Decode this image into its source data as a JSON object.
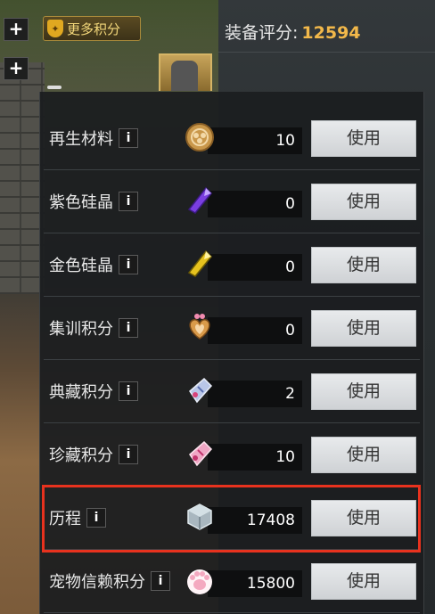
{
  "header": {
    "more_points_label": "更多积分",
    "score_label": "装备评分:",
    "score_value": "12594",
    "plus_icon": "+"
  },
  "info_glyph": "i",
  "use_label": "使用",
  "items": [
    {
      "name": "再生材料",
      "count": "10",
      "icon": "coin-icon",
      "color": "#c9974a"
    },
    {
      "name": "紫色硅晶",
      "count": "0",
      "icon": "purple-crystal-icon",
      "color": "#7a3ee0"
    },
    {
      "name": "金色硅晶",
      "count": "0",
      "icon": "gold-crystal-icon",
      "color": "#e6c21e"
    },
    {
      "name": "集训积分",
      "count": "0",
      "icon": "heart-badge-icon",
      "color": "#d99a4a"
    },
    {
      "name": "典藏积分",
      "count": "2",
      "icon": "blue-ticket-icon",
      "color": "#b9c6e8"
    },
    {
      "name": "珍藏积分",
      "count": "10",
      "icon": "pink-ticket-icon",
      "color": "#f0a6c4"
    },
    {
      "name": "历程",
      "count": "17408",
      "icon": "cube-icon",
      "color": "#a9b7bf"
    },
    {
      "name": "宠物信赖积分",
      "count": "15800",
      "icon": "paw-icon",
      "color": "#f4a9c0"
    }
  ],
  "highlighted_item": "历程"
}
